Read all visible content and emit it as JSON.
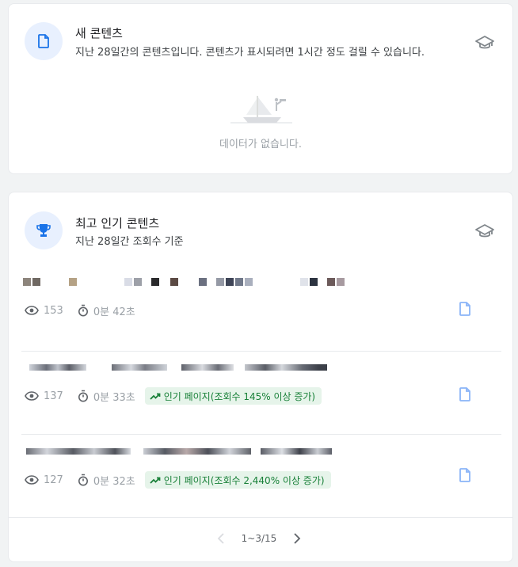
{
  "new_content": {
    "title": "새 콘텐츠",
    "subtitle": "지난 28일간의 콘텐츠입니다. 콘텐츠가 표시되려면 1시간 정도 걸릴 수 있습니다.",
    "icon": "document-icon",
    "empty_text": "데이터가 없습니다."
  },
  "top_content": {
    "title": "최고 인기 콘텐츠",
    "subtitle": "지난 28일간 조회수 기준",
    "icon": "trophy-icon",
    "rows": [
      {
        "views": "153",
        "duration": "0분 42초",
        "trend": ""
      },
      {
        "views": "137",
        "duration": "0분 33초",
        "trend": "인기 페이지(조회수 145% 이상 증가)"
      },
      {
        "views": "127",
        "duration": "0분 32초",
        "trend": "인기 페이지(조회수 2,440% 이상 증가)"
      }
    ]
  },
  "pagination": {
    "range": "1~3/15"
  },
  "colors": {
    "accent": "#1a73e8",
    "trend_bg": "#e6f4ea",
    "trend_fg": "#188038",
    "muted": "#9aa0a6"
  }
}
